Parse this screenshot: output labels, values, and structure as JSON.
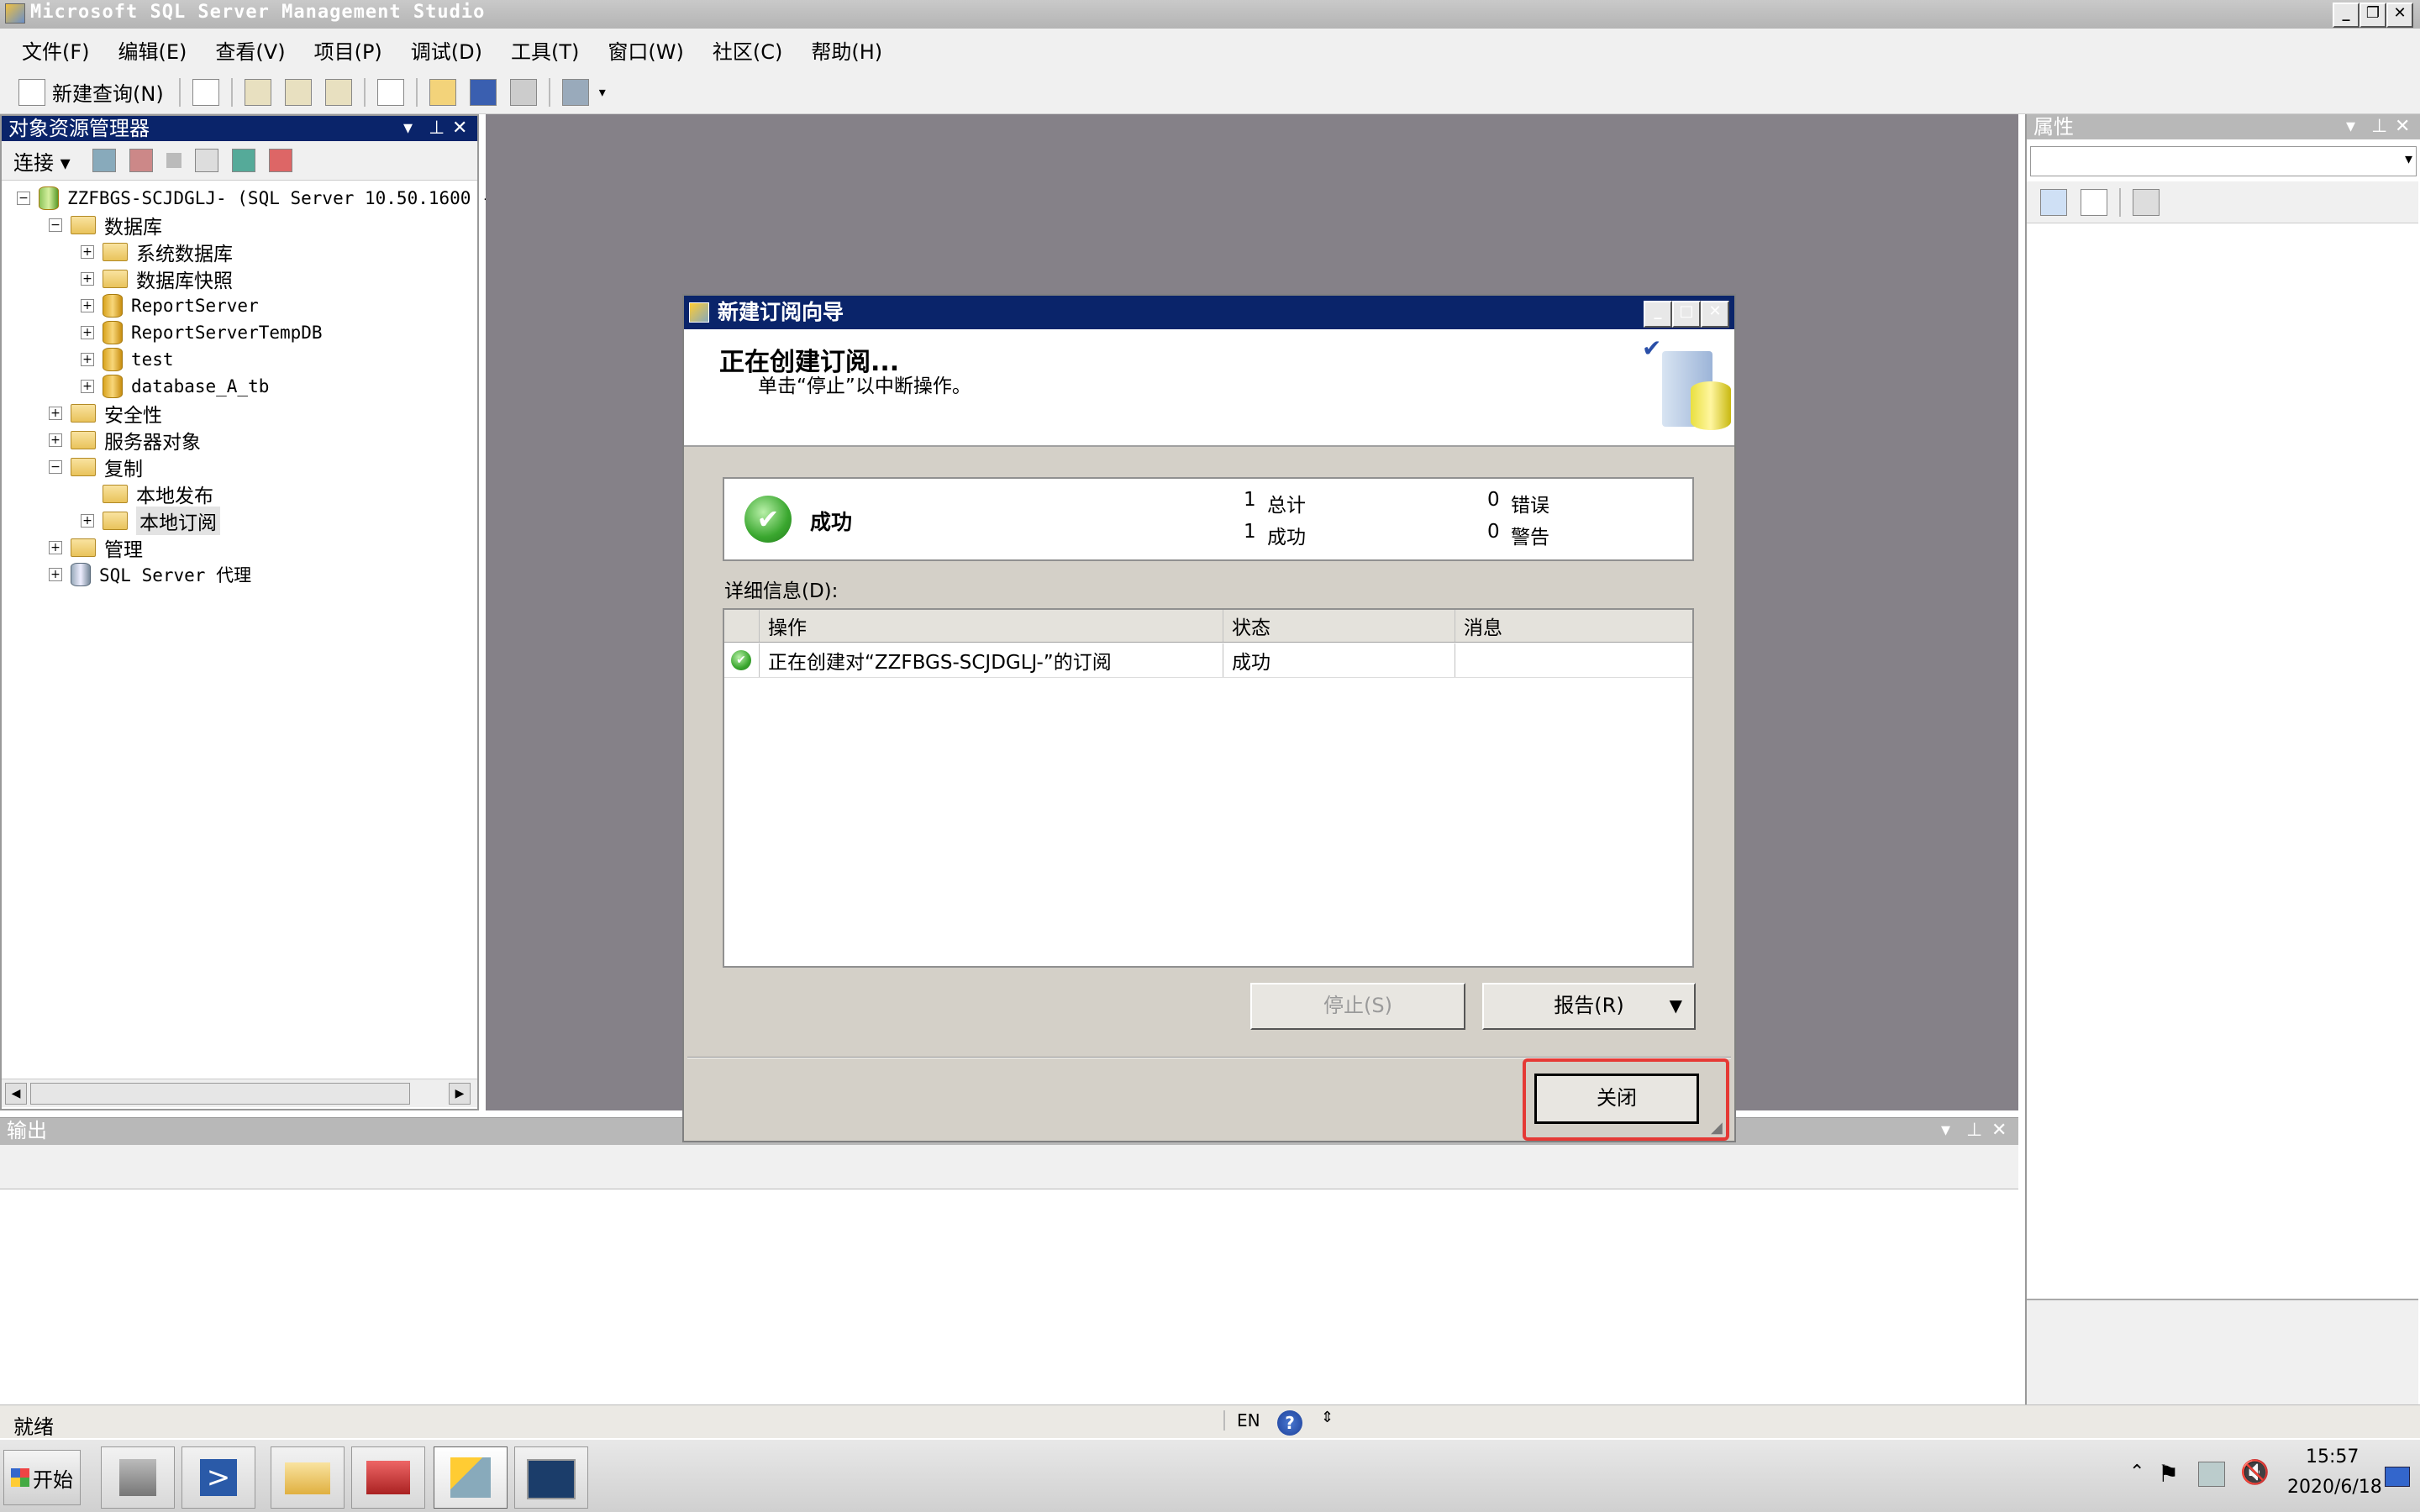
{
  "app": {
    "title": "Microsoft SQL Server Management Studio"
  },
  "menu": [
    "文件(F)",
    "编辑(E)",
    "查看(V)",
    "项目(P)",
    "调试(D)",
    "工具(T)",
    "窗口(W)",
    "社区(C)",
    "帮助(H)"
  ],
  "toolbar": {
    "new_query": "新建查询(N)"
  },
  "explorer": {
    "title": "对象资源管理器",
    "connect": "连接",
    "server": "ZZFBGS-SCJDGLJ- (SQL Server 10.50.1600 -",
    "databases": "数据库",
    "system_databases": "系统数据库",
    "snapshots": "数据库快照",
    "db1": "ReportServer",
    "db2": "ReportServerTempDB",
    "db3": "test",
    "db4": "database_A_tb",
    "security": "安全性",
    "server_objects": "服务器对象",
    "replication": "复制",
    "local_publications": "本地发布",
    "local_subscriptions": "本地订阅",
    "management": "管理",
    "agent": "SQL Server 代理"
  },
  "properties": {
    "title": "属性"
  },
  "output": {
    "title": "输出"
  },
  "status": {
    "text": "就绪",
    "lang": "EN"
  },
  "dialog": {
    "title": "新建订阅向导",
    "heading": "正在创建订阅...",
    "subheading": "单击“停止”以中断操作。",
    "result": "成功",
    "total_count": "1",
    "total_label": "总计",
    "success_count": "1",
    "success_label": "成功",
    "error_count": "0",
    "error_label": "错误",
    "warning_count": "0",
    "warning_label": "警告",
    "details_label": "详细信息(D):",
    "columns": [
      "操作",
      "状态",
      "消息"
    ],
    "row_action": "正在创建对“ZZFBGS-SCJDGLJ-”的订阅",
    "row_status": "成功",
    "row_message": "",
    "stop_button": "停止(S)",
    "report_button": "报告(R)",
    "close_button": "关闭"
  },
  "taskbar": {
    "start": "开始",
    "time": "15:57",
    "date": "2020/6/18"
  },
  "colors": {
    "highlight": "#e53935",
    "title_active": "#0a246a"
  }
}
